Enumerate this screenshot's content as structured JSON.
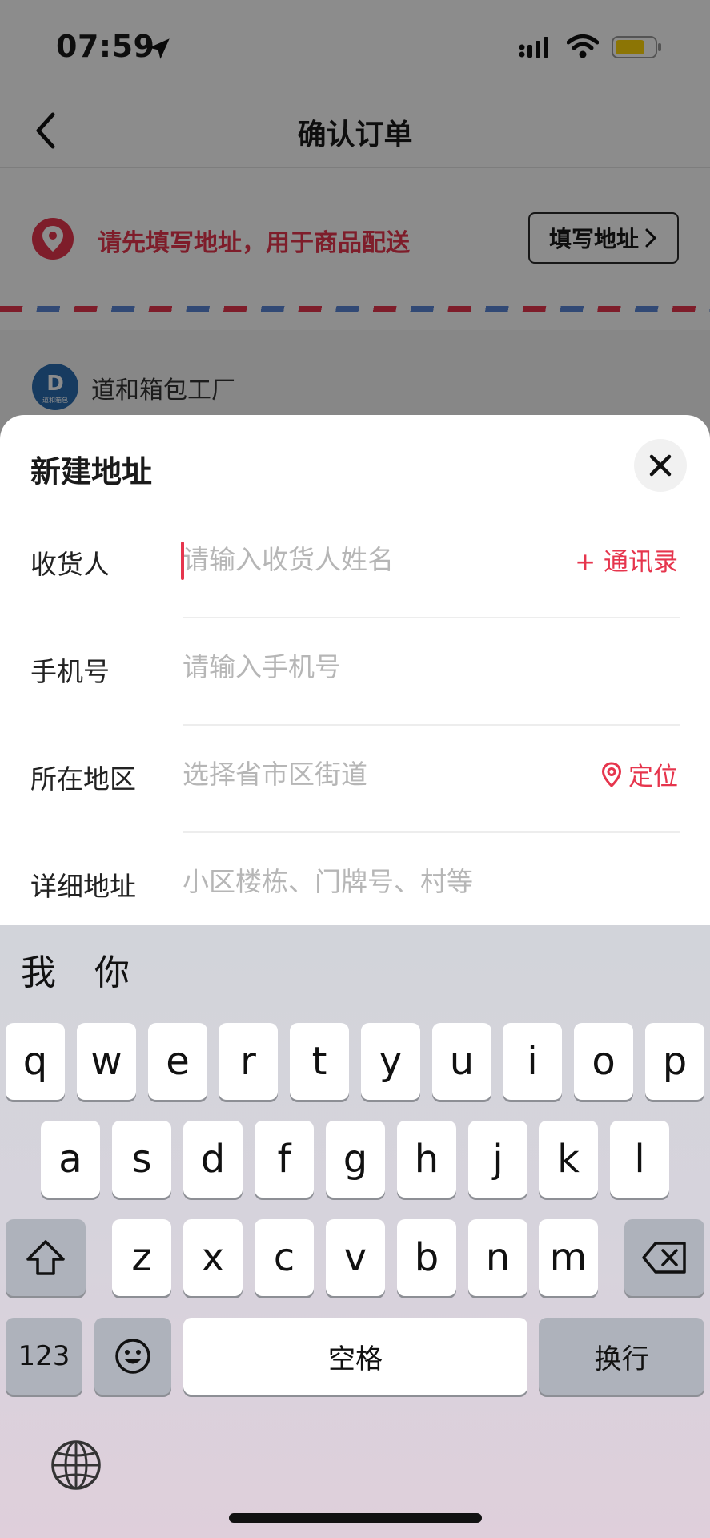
{
  "status_bar": {
    "time": "07:59"
  },
  "nav": {
    "title": "确认订单"
  },
  "address_prompt": {
    "message": "请先填写地址，用于商品配送",
    "button_label": "填写地址"
  },
  "shop": {
    "logo_letter": "D",
    "logo_caption": "道和箱包",
    "name": "道和箱包工厂"
  },
  "sheet": {
    "title": "新建地址",
    "fields": [
      {
        "label": "收货人",
        "placeholder": "请输入收货人姓名",
        "value": "",
        "action": "+ 通讯录"
      },
      {
        "label": "手机号",
        "placeholder": "请输入手机号",
        "value": ""
      },
      {
        "label": "所在地区",
        "placeholder": "选择省市区街道",
        "value": "",
        "action": "定位"
      },
      {
        "label": "详细地址",
        "placeholder": "小区楼栋、门牌号、村等",
        "value": ""
      }
    ]
  },
  "keyboard": {
    "candidates": [
      "我",
      "你"
    ],
    "row1": [
      "q",
      "w",
      "e",
      "r",
      "t",
      "y",
      "u",
      "i",
      "o",
      "p"
    ],
    "row2": [
      "a",
      "s",
      "d",
      "f",
      "g",
      "h",
      "j",
      "k",
      "l"
    ],
    "row3": [
      "z",
      "x",
      "c",
      "v",
      "b",
      "n",
      "m"
    ],
    "numbers_label": "123",
    "space_label": "空格",
    "return_label": "换行"
  },
  "colors": {
    "accent": "#e6354d",
    "airmail_blue": "#5a86d6",
    "battery": "#ffd60a"
  },
  "icons": [
    "location-arrow-icon",
    "signal-icon",
    "wifi-icon",
    "battery-icon",
    "back-chevron-icon",
    "location-pin-icon",
    "chevron-right-icon",
    "close-icon",
    "shift-icon",
    "delete-icon",
    "emoji-icon",
    "globe-icon"
  ]
}
